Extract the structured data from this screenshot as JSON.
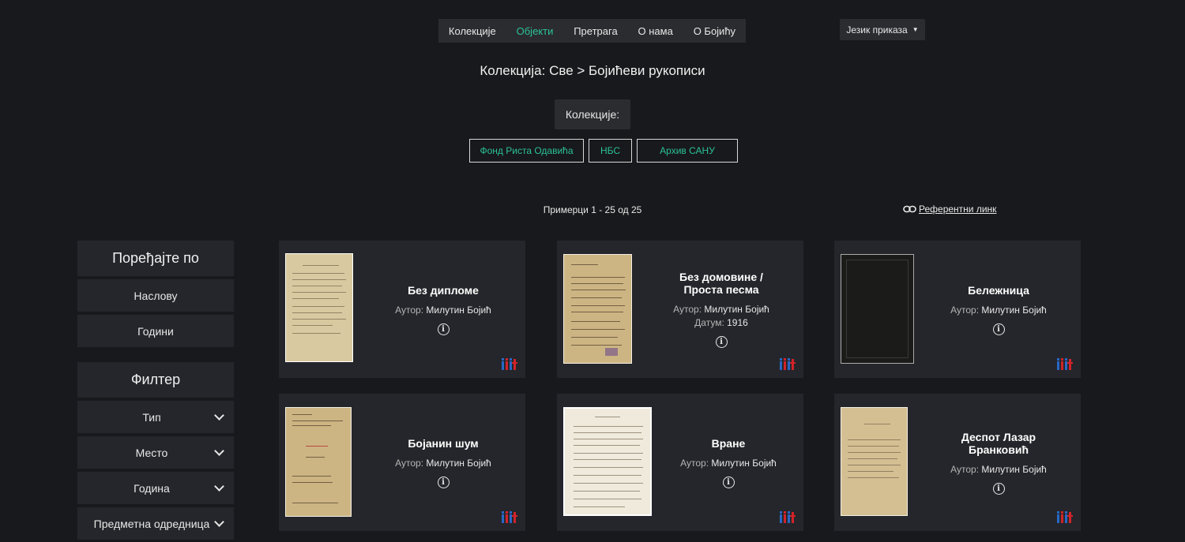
{
  "nav": {
    "items": [
      "Колекције",
      "Објекти",
      "Претрага",
      "О нама",
      "О Бојићу"
    ],
    "active_index": 1,
    "language_button": "Језик приказа"
  },
  "breadcrumb": "Колекција:  Све > Бојићеви рукописи",
  "collections": {
    "label": "Колекције:",
    "buttons": [
      "Фонд Риста Одавића",
      "НБС",
      "Архив САНУ"
    ]
  },
  "results_text": "Примерци 1 - 25 од 25",
  "reference_link": "Референтни линк",
  "sort": {
    "heading": "Поређајте по",
    "options": [
      "Наслову",
      "Години"
    ]
  },
  "filter": {
    "heading": "Филтер",
    "options": [
      "Тип",
      "Место",
      "Година",
      "Предметна одредница"
    ]
  },
  "cards": [
    {
      "title": "Без дипломе",
      "author_label": "Аутор:",
      "author": "Милутин Бојић",
      "date_label": "",
      "date": ""
    },
    {
      "title": "Без домовине / Проста песма",
      "author_label": "Аутор:",
      "author": "Милутин Бојић",
      "date_label": "Датум:",
      "date": "1916"
    },
    {
      "title": "Бележница",
      "author_label": "Аутор:",
      "author": "Милутин Бојић",
      "date_label": "",
      "date": ""
    },
    {
      "title": "Бојанин шум",
      "author_label": "Аутор:",
      "author": "Милутин Бојић",
      "date_label": "",
      "date": ""
    },
    {
      "title": "Вране",
      "author_label": "Аутор:",
      "author": "Милутин Бојић",
      "date_label": "",
      "date": ""
    },
    {
      "title": "Деспот Лазар Бранковић",
      "author_label": "Аутор:",
      "author": "Милутин Бојић",
      "date_label": "",
      "date": ""
    }
  ],
  "colors": {
    "background": "#18191c",
    "panel": "#25262b",
    "accent": "#2bc29a",
    "iiif_blue": "#2868c6",
    "iiif_red": "#d2232a"
  }
}
